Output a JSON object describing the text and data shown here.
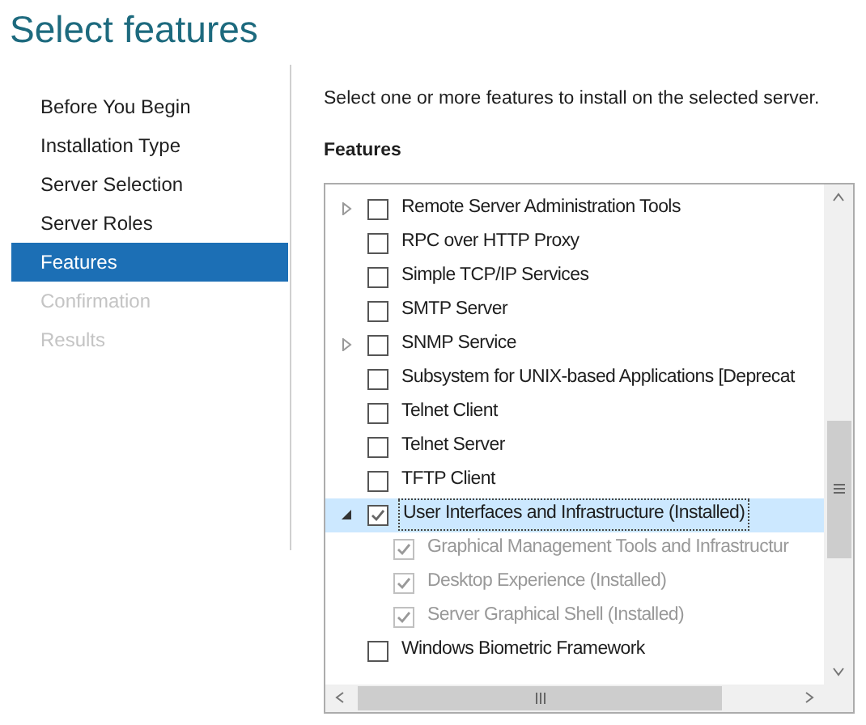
{
  "title": "Select features",
  "steps": [
    {
      "label": "Before You Begin",
      "selected": false,
      "disabled": false
    },
    {
      "label": "Installation Type",
      "selected": false,
      "disabled": false
    },
    {
      "label": "Server Selection",
      "selected": false,
      "disabled": false
    },
    {
      "label": "Server Roles",
      "selected": false,
      "disabled": false
    },
    {
      "label": "Features",
      "selected": true,
      "disabled": false
    },
    {
      "label": "Confirmation",
      "selected": false,
      "disabled": true
    },
    {
      "label": "Results",
      "selected": false,
      "disabled": true
    }
  ],
  "instruction": "Select one or more features to install on the selected server.",
  "features_heading": "Features",
  "features": [
    {
      "label": "Remote Server Administration Tools",
      "checked": false,
      "selected": false,
      "expandable": true,
      "expanded": false
    },
    {
      "label": "RPC over HTTP Proxy",
      "checked": false,
      "selected": false,
      "expandable": false
    },
    {
      "label": "Simple TCP/IP Services",
      "checked": false,
      "selected": false,
      "expandable": false
    },
    {
      "label": "SMTP Server",
      "checked": false,
      "selected": false,
      "expandable": false
    },
    {
      "label": "SNMP Service",
      "checked": false,
      "selected": false,
      "expandable": true,
      "expanded": false
    },
    {
      "label": "Subsystem for UNIX-based Applications [Deprecat",
      "checked": false,
      "selected": false,
      "expandable": false
    },
    {
      "label": "Telnet Client",
      "checked": false,
      "selected": false,
      "expandable": false
    },
    {
      "label": "Telnet Server",
      "checked": false,
      "selected": false,
      "expandable": false
    },
    {
      "label": "TFTP Client",
      "checked": false,
      "selected": false,
      "expandable": false
    },
    {
      "label": "User Interfaces and Infrastructure (Installed)",
      "checked": true,
      "selected": true,
      "expandable": true,
      "expanded": true,
      "children": [
        {
          "label": "Graphical Management Tools and Infrastructur",
          "checked": true,
          "disabled": true,
          "selected": false
        },
        {
          "label": "Desktop Experience (Installed)",
          "checked": true,
          "disabled": true,
          "selected": false
        },
        {
          "label": "Server Graphical Shell (Installed)",
          "checked": true,
          "disabled": true,
          "selected": false
        }
      ]
    },
    {
      "label": "Windows Biometric Framework",
      "checked": false,
      "selected": false,
      "expandable": false
    }
  ]
}
